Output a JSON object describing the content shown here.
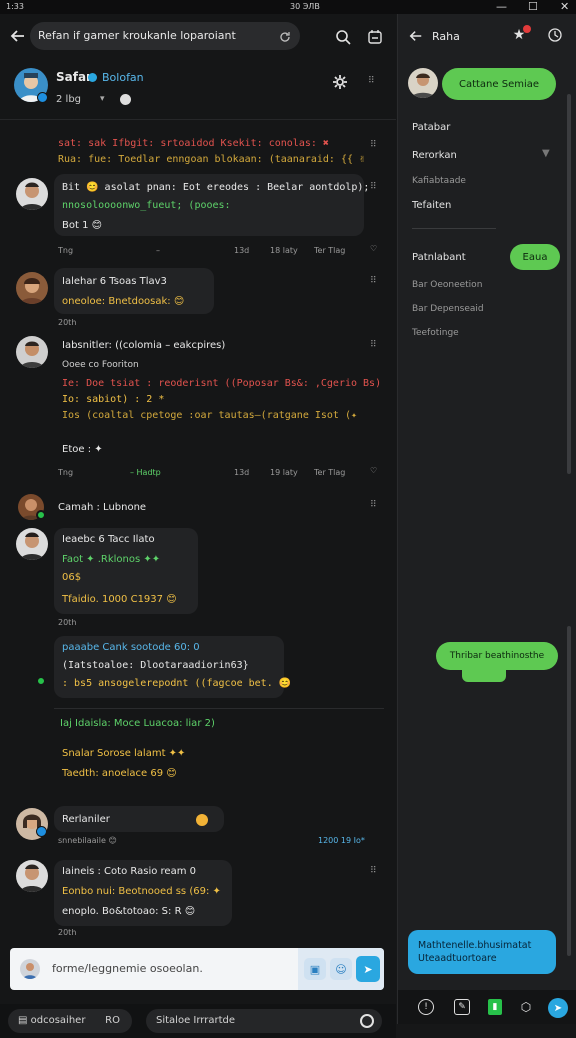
{
  "status": {
    "time": "1:33",
    "center": "30 ЭЛВ"
  },
  "window": {
    "minimize": "—",
    "maximize": "☐",
    "close": "✕"
  },
  "header": {
    "search_text": "Refan if gamer kroukanle loparoiant"
  },
  "profile": {
    "name": "Safar",
    "name_tag": "Bolofan",
    "sub": "2 lbg",
    "sub_caret": "▾"
  },
  "messages": [
    {
      "lines": [
        "sat: sak Ifbgit: srtoaidod Ksekit: conolas: ✖",
        "Rua: fue: Toedlar enngoan blokaan: (taanaraid: {{ ✌"
      ]
    },
    {
      "lines": [
        "Bit 😊 asolat pnan: Eot ereodes : Beelar aontdolp);",
        "nnosoloooonwo_fueut; (pooes:",
        "Bot 1 😊"
      ],
      "meta": {
        "left": "Tng",
        "mid": "–",
        "a": "13d",
        "b": "18 laty",
        "c": "Ter Tlag"
      }
    },
    {
      "lines": [
        "Ialehar 6 Tsoas Tlav3",
        "oneoloe: Bnetdoosak: 😊"
      ],
      "meta": {
        "left": "20th"
      }
    },
    {
      "lines": [
        "Iabsnitler: ((colomia – eakcpires)",
        "Ooee co Fooriton",
        "Ie: Doe tsiat : reoderisnt ((Poposar Bs&: ,Cgerio Bs)",
        "Io: sabiot) : 2 *",
        "Ios (coaltal cpetoge :oar tautas–(ratgane Isot (✦",
        "Etoe : ✦"
      ],
      "meta": {
        "left": "Tng",
        "mid": "– Hadtp",
        "a": "13d",
        "b": "19 laty",
        "c": "Ter Tlag"
      }
    },
    {
      "lines": [
        "Camah : Lubnone"
      ]
    },
    {
      "lines": [
        "Ieaebc 6 Tacc Ilato",
        "Faot ✦ .Rklonos ✦✦",
        "06$",
        "Tfaidio. 1000 C1937 😊"
      ],
      "meta": {
        "left": "20th"
      }
    },
    {
      "lines": [
        "paaabe Cank sootode 60: 0",
        "(Iatstoaloe: Dlootaraadiorin63}",
        ": bs5 ansogelerepodnt ((fagcoe bet. 😊"
      ]
    },
    {
      "lines": [
        "Iaj Idaisla: Moce Luacoa: liar 2)"
      ]
    },
    {
      "lines": [
        "Snalar Sorose lalamt ✦✦",
        "Taedth: anoelace 69 😊"
      ]
    },
    {
      "lines": [
        "Rerlaniler"
      ],
      "meta": {
        "left": "snnebilaaile 😊",
        "right": "1200 19 Io*"
      }
    },
    {
      "lines": [
        "Iaineis : Coto Rasio ream 0",
        "Eonbo nui: Beotnooed ss (69: ✦",
        "enoplo. Bo&totoao: S: R 😊"
      ],
      "meta": {
        "left": "20th"
      }
    }
  ],
  "composer": {
    "placeholder": "forme/Ieggnemie osoeolan."
  },
  "bottombar": {
    "left_label": "odcosaiher",
    "left_count": "RO",
    "right_label": "Sitaloe Irrrartde"
  },
  "sidebar": {
    "title": "Raha",
    "top_pill": "Cattane Semiae",
    "items": [
      "Patabar",
      "Rerorkan",
      "Kafiabtaade",
      "Tefaiten"
    ],
    "section": "Patnlabant",
    "section_pill": "Eaua",
    "sub_items": [
      "Bar Oeoneetion",
      "Bar Depenseaid",
      "Teefotinge"
    ],
    "mid_pill": "Thribar beathinosthe",
    "footer_text": "Mathtenelle.bhusimatat Uteaadtuortoare"
  },
  "colors": {
    "accent_green": "#5ec952",
    "accent_blue": "#2aa7e0",
    "bg": "#151617"
  }
}
